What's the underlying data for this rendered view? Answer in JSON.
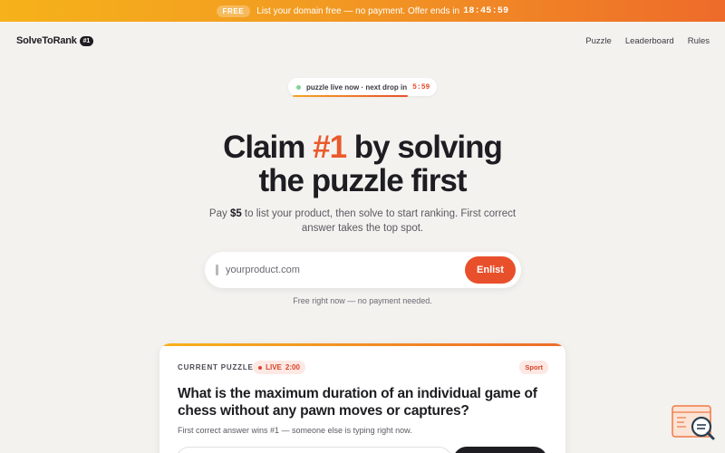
{
  "promo": {
    "badge": "FREE",
    "text": "List your domain free — no payment. Offer ends in",
    "timer": "18:45:59"
  },
  "header": {
    "logo": "SolveToRank",
    "logo_badge": "#1",
    "nav": [
      "Puzzle",
      "Leaderboard",
      "Rules"
    ]
  },
  "live_pill": {
    "text": "puzzle live now · next drop in",
    "countdown": "5:59"
  },
  "hero": {
    "title_part1": "Claim ",
    "title_accent": "#1",
    "title_part2": " by solving",
    "title_line2": "the puzzle first",
    "sub_prefix": "Pay ",
    "sub_price": "$5",
    "sub_rest": " to list your product, then solve to start ranking. First correct answer takes the top spot."
  },
  "enlist": {
    "placeholder": "yourproduct.com",
    "button": "Enlist",
    "note": "Free right now — no payment needed."
  },
  "puzzle": {
    "label": "CURRENT PUZZLE",
    "live_label": "LIVE",
    "live_time": "2:00",
    "category": "Sport",
    "question": "What is the maximum duration of an individual game of chess without any pawn moves or captures?",
    "note": "First correct answer wins #1 — someone else is typing right now."
  },
  "colors": {
    "accent": "#e8502c",
    "background": "#f4f2ef",
    "banner_start": "#f6b21a",
    "banner_end": "#ee6b2a"
  }
}
